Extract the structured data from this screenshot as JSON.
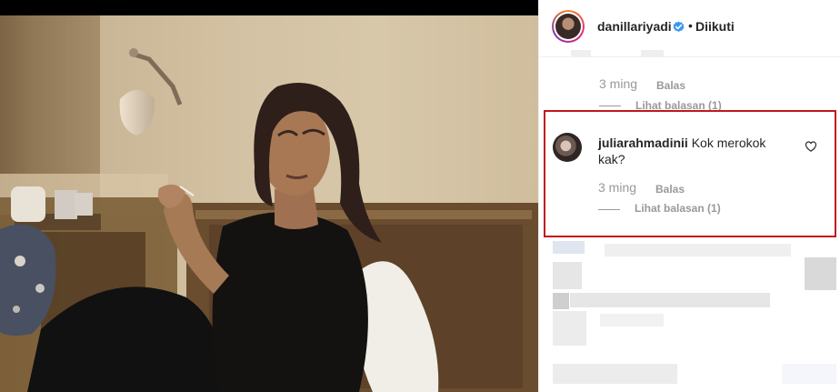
{
  "post": {
    "username": "danillariyadi",
    "follow_status": "Diikuti"
  },
  "previous_comment": {
    "time": "3 ming",
    "reply_label": "Balas",
    "view_replies": "Lihat balasan (1)"
  },
  "highlighted_comment": {
    "username": "juliarahmadinii",
    "text": "Kok merokok kak?",
    "time": "3 ming",
    "reply_label": "Balas",
    "view_replies": "Lihat balasan (1)"
  },
  "colors": {
    "highlight_border": "#c0181d",
    "verified_badge": "#3897f0"
  }
}
